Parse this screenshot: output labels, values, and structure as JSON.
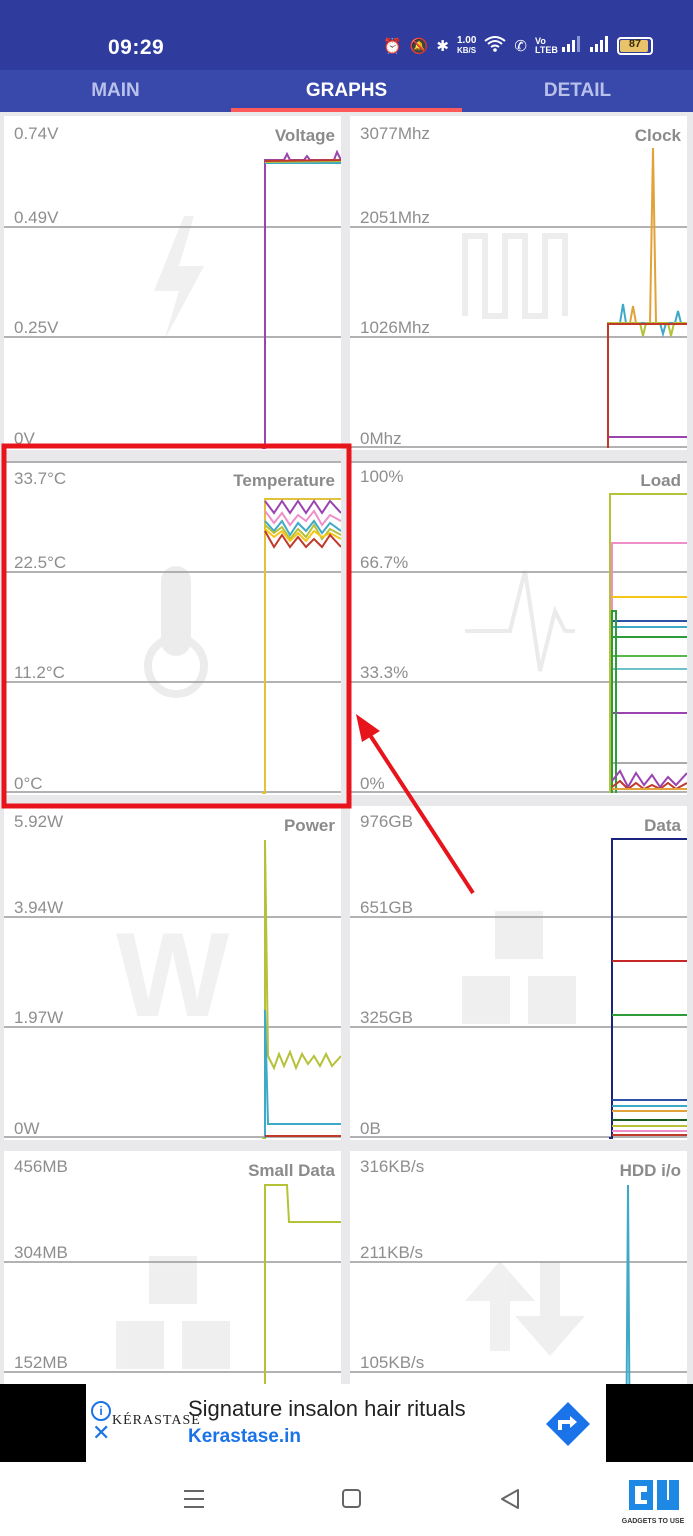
{
  "status_bar": {
    "time": "09:29",
    "speed_value": "1.00",
    "speed_unit": "KB/S",
    "battery_level": "87",
    "sim_label": "Vo LTEB"
  },
  "tabs": [
    {
      "label": "MAIN",
      "active": false
    },
    {
      "label": "GRAPHS",
      "active": true
    },
    {
      "label": "DETAIL",
      "active": false
    }
  ],
  "panels": {
    "voltage": {
      "title": "Voltage",
      "labels": [
        "0.74V",
        "0.49V",
        "0.25V",
        "0V"
      ]
    },
    "clock": {
      "title": "Clock",
      "labels": [
        "3077Mhz",
        "2051Mhz",
        "1026Mhz",
        "0Mhz"
      ]
    },
    "temperature": {
      "title": "Temperature",
      "labels": [
        "33.7°C",
        "22.5°C",
        "11.2°C",
        "0°C"
      ]
    },
    "load": {
      "title": "Load",
      "labels": [
        "100%",
        "66.7%",
        "33.3%",
        "0%"
      ]
    },
    "power": {
      "title": "Power",
      "labels": [
        "5.92W",
        "3.94W",
        "1.97W",
        "0W"
      ]
    },
    "data": {
      "title": "Data",
      "labels": [
        "976GB",
        "651GB",
        "325GB",
        "0B"
      ]
    },
    "small_data": {
      "title": "Small Data",
      "labels": [
        "456MB",
        "304MB",
        "152MB"
      ]
    },
    "hdd_io": {
      "title": "HDD i/o",
      "labels": [
        "316KB/s",
        "211KB/s",
        "105KB/s"
      ]
    }
  },
  "ad": {
    "brand": "KÉRASTASE",
    "headline": "Signature insalon hair rituals",
    "link": "Kerastase.in"
  },
  "watermark": "GADGETS TO USE",
  "colors": {
    "status_bar": "#2f3c9e",
    "tab_bar": "#3949ab",
    "tab_indicator": "#ff5a5a",
    "highlight_box": "#e8141b",
    "ad_link": "#1a73e8"
  }
}
